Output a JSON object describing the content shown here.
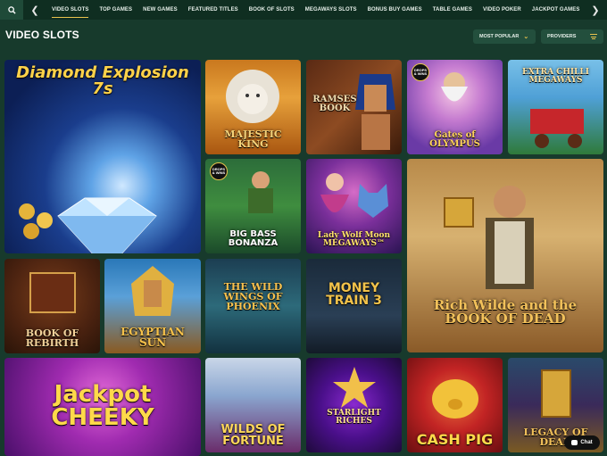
{
  "nav": {
    "items": [
      "VIDEO SLOTS",
      "TOP GAMES",
      "NEW GAMES",
      "FEATURED TITLES",
      "BOOK OF SLOTS",
      "MEGAWAYS SLOTS",
      "BONUS BUY GAMES",
      "TABLE GAMES",
      "VIDEO POKER",
      "JACKPOT GAMES"
    ],
    "active": "VIDEO SLOTS"
  },
  "header": {
    "title": "VIDEO SLOTS",
    "sort_label": "MOST POPULAR",
    "providers_label": "PROVIDERS"
  },
  "games": [
    {
      "title": "Diamond Explosion 7s"
    },
    {
      "title": "MAJESTIC KING"
    },
    {
      "title": "RAMSES BOOK"
    },
    {
      "title": "Gates of OLYMPUS",
      "badge": "DROPS & WINS"
    },
    {
      "title": "EXTRA CHILLI MEGAWAYS"
    },
    {
      "title": "BIG BASS BONANZA",
      "badge": "DROPS & WINS"
    },
    {
      "title": "Lady Wolf Moon MEGAWAYS™"
    },
    {
      "title": "Rich Wilde and the BOOK OF DEAD"
    },
    {
      "title": "BOOK OF REBIRTH"
    },
    {
      "title": "EGYPTIAN SUN"
    },
    {
      "title": "THE WILD WINGS OF PHOENIX"
    },
    {
      "title": "MONEY TRAIN 3"
    },
    {
      "title": "Jackpot CHEEKY"
    },
    {
      "title": "WILDS OF FORTUNE"
    },
    {
      "title": "STARLIGHT RICHES"
    },
    {
      "title": "CASH PIG"
    },
    {
      "title": "LEGACY OF DEAD"
    }
  ],
  "chat": {
    "label": "Chat"
  }
}
